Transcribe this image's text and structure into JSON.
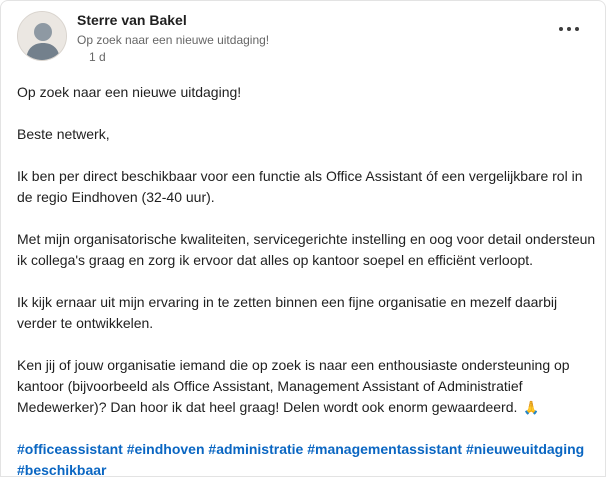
{
  "author": {
    "name": "Sterre van Bakel",
    "headline": "Op zoek naar een nieuwe uitdaging!",
    "time": "1 d"
  },
  "menu": {
    "icon": "more-horizontal-icon"
  },
  "post": {
    "paragraphs": [
      "Op zoek naar een nieuwe uitdaging!",
      "Beste netwerk,",
      "Ik ben per direct beschikbaar voor een functie als Office Assistant óf een vergelijkbare rol in de regio Eindhoven (32-40 uur).",
      "Met mijn organisatorische kwaliteiten, servicegerichte instelling en oog voor detail ondersteun ik collega's graag en zorg ik ervoor dat alles op kantoor soepel en efficiënt verloopt.",
      "Ik kijk ernaar uit mijn ervaring in te zetten binnen een fijne organisatie en mezelf daarbij verder te ontwikkelen.",
      "Ken jij of jouw organisatie iemand die op zoek is naar een enthousiaste ondersteuning op kantoor (bijvoorbeeld als Office Assistant, Management Assistant of Administratief Medewerker)? Dan hoor ik dat heel graag! Delen wordt ook enorm gewaardeerd."
    ],
    "emoji": "🙏",
    "emoji_name": "folded-hands-icon",
    "hashtags": [
      "#officeassistant",
      "#eindhoven",
      "#administratie",
      "#managementassistant",
      "#nieuweuitdaging",
      "#beschikbaar"
    ]
  },
  "colors": {
    "link": "#0a66c2",
    "secondary_text": "#666666",
    "primary_text": "#1f1f1f"
  }
}
